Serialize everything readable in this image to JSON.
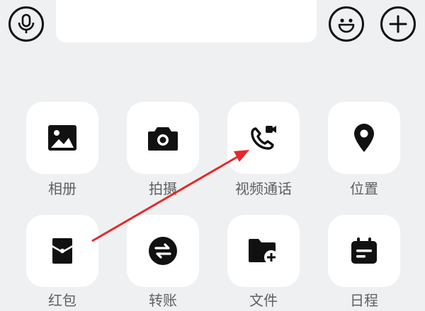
{
  "toolbar": {
    "voice_icon": "microphone-icon",
    "text_input_value": "",
    "emoji_icon": "smiley-icon",
    "more_icon": "plus-icon"
  },
  "panel": {
    "items": [
      {
        "label": "相册",
        "icon": "image-icon"
      },
      {
        "label": "拍摄",
        "icon": "camera-icon"
      },
      {
        "label": "视频通话",
        "icon": "video-call-icon"
      },
      {
        "label": "位置",
        "icon": "location-pin-icon"
      },
      {
        "label": "红包",
        "icon": "red-envelope-icon"
      },
      {
        "label": "转账",
        "icon": "transfer-icon"
      },
      {
        "label": "文件",
        "icon": "folder-add-icon"
      },
      {
        "label": "日程",
        "icon": "calendar-icon"
      }
    ]
  },
  "annotation": {
    "color": "#e8272a"
  }
}
